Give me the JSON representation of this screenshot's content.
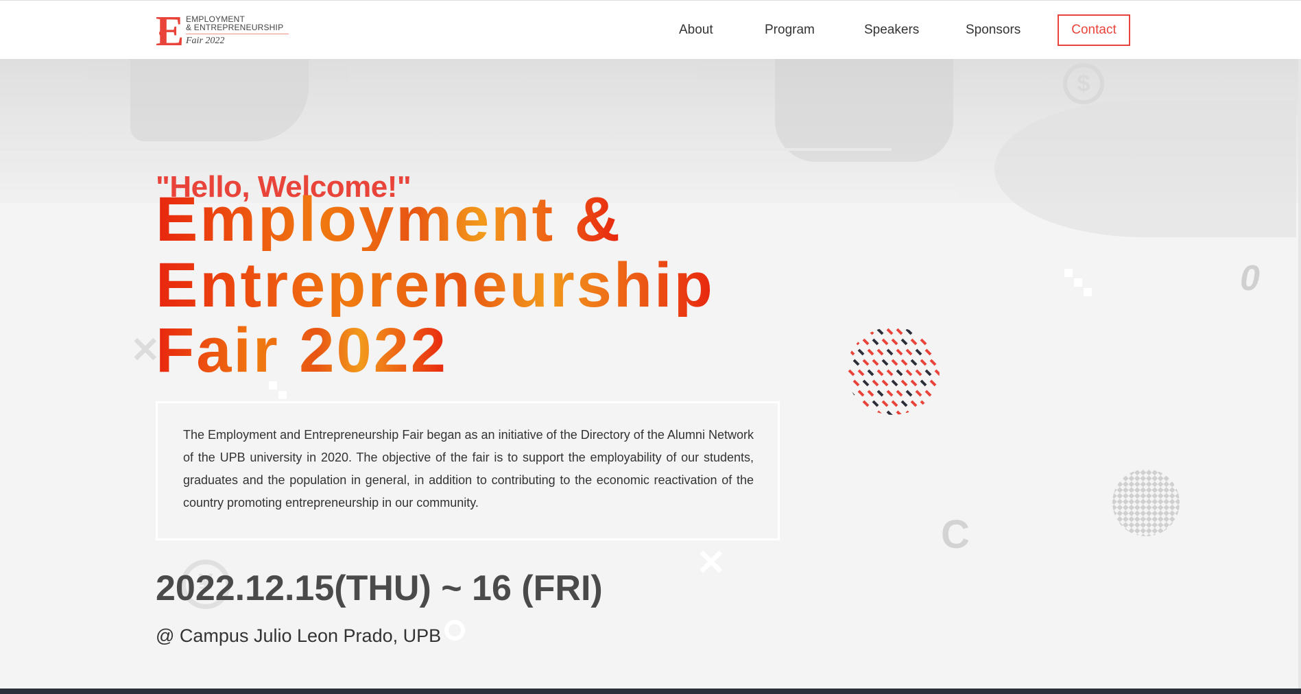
{
  "header": {
    "logo": {
      "letter": "E",
      "line1": "EMPLOYMENT",
      "line2": "& ENTREPRENEURSHIP",
      "subtitle": "Fair 2022"
    },
    "nav": [
      {
        "label": "About"
      },
      {
        "label": "Program"
      },
      {
        "label": "Speakers"
      },
      {
        "label": "Sponsors"
      },
      {
        "label": "Contact"
      }
    ]
  },
  "hero": {
    "greeting": "\"Hello, Welcome!\"",
    "title_lines": [
      "Employment &",
      "Entrepreneurship",
      "Fair 2022"
    ],
    "description": "The Employment and Entrepreneurship Fair began as an initiative of the Directory of the Alumni Network of the UPB university in 2020. The objective of the fair is to support the employability of our students, graduates and the population in general, in addition to contributing to the economic reactivation of the country promoting entrepreneurship in our community.",
    "date": "2022.12.15(THU) ~ 16 (FRI)",
    "venue": "@ Campus Julio Leon Prado, UPB"
  },
  "colors": {
    "accent": "#e8443a",
    "dark": "#2b2f3a",
    "text": "#333333"
  }
}
